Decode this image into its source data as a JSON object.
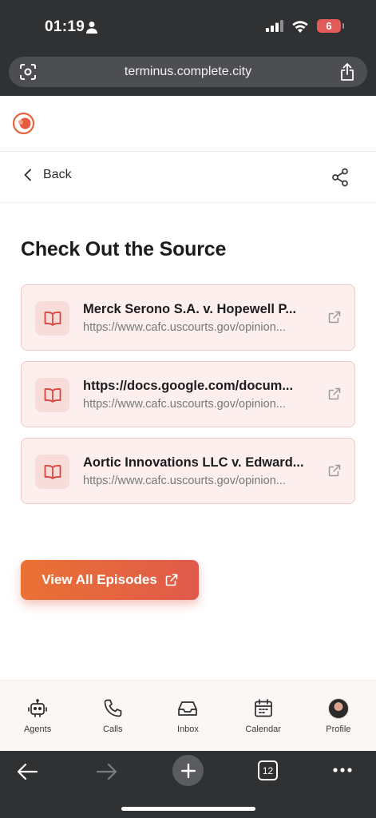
{
  "status_bar": {
    "time": "01:19",
    "battery": "6",
    "icons": [
      "person-icon",
      "signal-icon",
      "wifi-icon",
      "battery-icon"
    ]
  },
  "browser": {
    "url": "terminus.complete.city",
    "tab_count": "12"
  },
  "header": {
    "back_label": "Back"
  },
  "page": {
    "title": "Check Out the Source"
  },
  "sources": [
    {
      "title": "Merck Serono S.A. v. Hopewell P...",
      "url": "https://www.cafc.uscourts.gov/opinion..."
    },
    {
      "title": "https://docs.google.com/docum...",
      "url": "https://www.cafc.uscourts.gov/opinion..."
    },
    {
      "title": "Aortic Innovations LLC v. Edward...",
      "url": "https://www.cafc.uscourts.gov/opinion..."
    }
  ],
  "cta": {
    "view_all_label": "View All Episodes"
  },
  "tab_bar": {
    "items": [
      {
        "label": "Agents",
        "icon": "robot-icon"
      },
      {
        "label": "Calls",
        "icon": "phone-icon"
      },
      {
        "label": "Inbox",
        "icon": "inbox-icon"
      },
      {
        "label": "Calendar",
        "icon": "calendar-icon"
      },
      {
        "label": "Profile",
        "icon": "avatar"
      }
    ]
  },
  "colors": {
    "accent": "#e8643f",
    "card_bg": "#fcefee",
    "card_border": "#f2c9c6",
    "chrome": "#2f3133"
  }
}
